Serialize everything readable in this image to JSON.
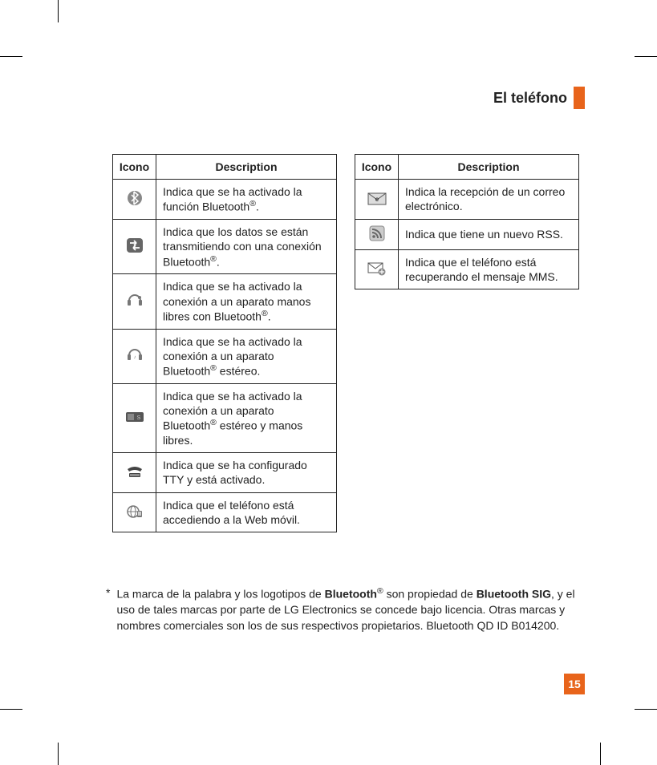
{
  "section_title": "El teléfono",
  "page_number": "15",
  "table1": {
    "header_icon": "Icono",
    "header_desc": "Description",
    "rows": [
      {
        "icon": "bluetooth-on-icon",
        "desc_pre": "Indica que se ha activado la función Bluetooth",
        "reg": "®",
        "desc_post": "."
      },
      {
        "icon": "bluetooth-transfer-icon",
        "desc_pre": "Indica que los datos se están transmitiendo con una conexión Bluetooth",
        "reg": "®",
        "desc_post": "."
      },
      {
        "icon": "bluetooth-handsfree-icon",
        "desc_pre": "Indica que se ha activado la conexión a un aparato manos libres con Bluetooth",
        "reg": "®",
        "desc_post": "."
      },
      {
        "icon": "bluetooth-stereo-icon",
        "desc_pre": "Indica que se ha activado la conexión a un aparato Bluetooth",
        "reg": "®",
        "desc_post": " estéreo."
      },
      {
        "icon": "bluetooth-stereo-hf-icon",
        "desc_pre": "Indica que se ha activado la conexión a un aparato Bluetooth",
        "reg": "®",
        "desc_post": " estéreo y manos libres."
      },
      {
        "icon": "tty-icon",
        "desc_pre": "Indica que se ha configurado TTY y está activado.",
        "reg": "",
        "desc_post": ""
      },
      {
        "icon": "mobile-web-icon",
        "desc_pre": "Indica que el teléfono está accediendo a la Web móvil.",
        "reg": "",
        "desc_post": ""
      }
    ]
  },
  "table2": {
    "header_icon": "Icono",
    "header_desc": "Description",
    "rows": [
      {
        "icon": "email-icon",
        "desc": "Indica la recepción de un correo electrónico."
      },
      {
        "icon": "rss-icon",
        "desc": "Indica que tiene un nuevo RSS."
      },
      {
        "icon": "mms-retrieve-icon",
        "desc": "Indica que el teléfono está recuperando el mensaje MMS."
      }
    ]
  },
  "footnote": {
    "asterisk": "*",
    "p1": "La marca de la palabra y los logotipos de ",
    "b1": "Bluetooth",
    "reg": "®",
    "p2": " son propiedad de ",
    "b2": "Bluetooth SIG",
    "p3": ", y el uso de tales marcas por parte de LG Electronics se concede bajo licencia. Otras marcas y nombres comerciales son los de sus respectivos propietarios. Bluetooth QD ID B014200."
  }
}
